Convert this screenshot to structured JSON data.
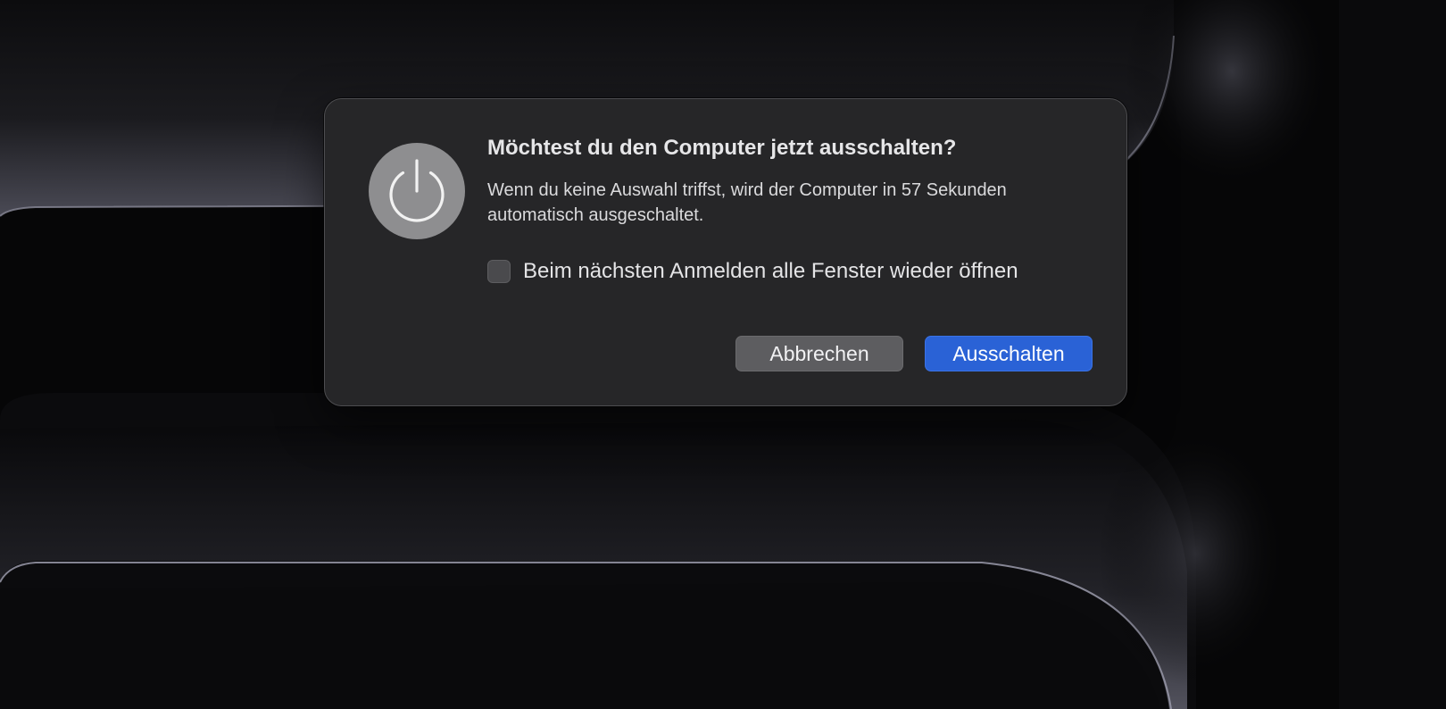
{
  "dialog": {
    "title": "Möchtest du den Computer jetzt ausschalten?",
    "message": "Wenn du keine Auswahl triffst, wird der Computer in 57 Sekunden automatisch ausgeschaltet.",
    "checkbox": {
      "label": "Beim nächsten Anmelden alle Fenster wieder öffnen",
      "checked": false
    },
    "buttons": {
      "cancel": "Abbrechen",
      "confirm": "Ausschalten"
    },
    "icon": "power-icon"
  },
  "colors": {
    "accent": "#2a62d6",
    "dialog_background": "#262628",
    "wallpaper": "#060607"
  }
}
